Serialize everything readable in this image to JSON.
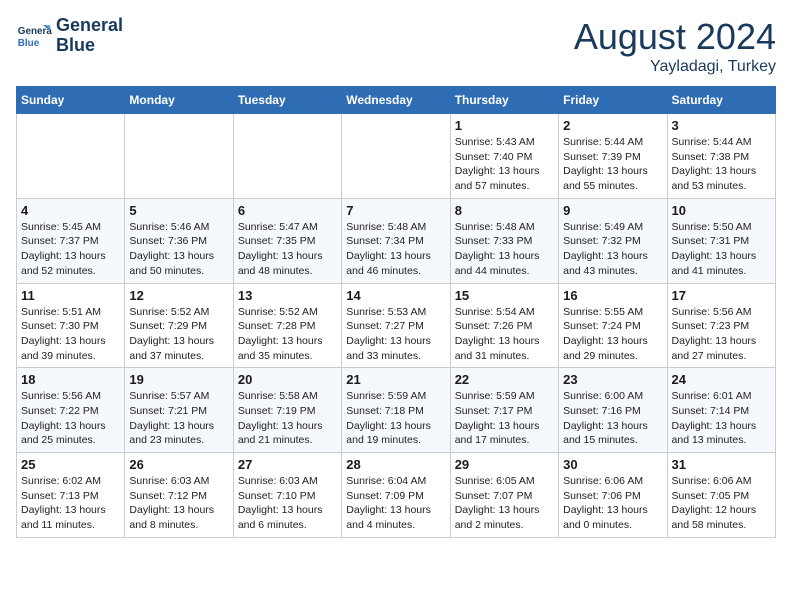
{
  "header": {
    "logo_line1": "General",
    "logo_line2": "Blue",
    "month_year": "August 2024",
    "location": "Yayladagi, Turkey"
  },
  "days_of_week": [
    "Sunday",
    "Monday",
    "Tuesday",
    "Wednesday",
    "Thursday",
    "Friday",
    "Saturday"
  ],
  "weeks": [
    [
      {
        "day": "",
        "info": ""
      },
      {
        "day": "",
        "info": ""
      },
      {
        "day": "",
        "info": ""
      },
      {
        "day": "",
        "info": ""
      },
      {
        "day": "1",
        "info": "Sunrise: 5:43 AM\nSunset: 7:40 PM\nDaylight: 13 hours\nand 57 minutes."
      },
      {
        "day": "2",
        "info": "Sunrise: 5:44 AM\nSunset: 7:39 PM\nDaylight: 13 hours\nand 55 minutes."
      },
      {
        "day": "3",
        "info": "Sunrise: 5:44 AM\nSunset: 7:38 PM\nDaylight: 13 hours\nand 53 minutes."
      }
    ],
    [
      {
        "day": "4",
        "info": "Sunrise: 5:45 AM\nSunset: 7:37 PM\nDaylight: 13 hours\nand 52 minutes."
      },
      {
        "day": "5",
        "info": "Sunrise: 5:46 AM\nSunset: 7:36 PM\nDaylight: 13 hours\nand 50 minutes."
      },
      {
        "day": "6",
        "info": "Sunrise: 5:47 AM\nSunset: 7:35 PM\nDaylight: 13 hours\nand 48 minutes."
      },
      {
        "day": "7",
        "info": "Sunrise: 5:48 AM\nSunset: 7:34 PM\nDaylight: 13 hours\nand 46 minutes."
      },
      {
        "day": "8",
        "info": "Sunrise: 5:48 AM\nSunset: 7:33 PM\nDaylight: 13 hours\nand 44 minutes."
      },
      {
        "day": "9",
        "info": "Sunrise: 5:49 AM\nSunset: 7:32 PM\nDaylight: 13 hours\nand 43 minutes."
      },
      {
        "day": "10",
        "info": "Sunrise: 5:50 AM\nSunset: 7:31 PM\nDaylight: 13 hours\nand 41 minutes."
      }
    ],
    [
      {
        "day": "11",
        "info": "Sunrise: 5:51 AM\nSunset: 7:30 PM\nDaylight: 13 hours\nand 39 minutes."
      },
      {
        "day": "12",
        "info": "Sunrise: 5:52 AM\nSunset: 7:29 PM\nDaylight: 13 hours\nand 37 minutes."
      },
      {
        "day": "13",
        "info": "Sunrise: 5:52 AM\nSunset: 7:28 PM\nDaylight: 13 hours\nand 35 minutes."
      },
      {
        "day": "14",
        "info": "Sunrise: 5:53 AM\nSunset: 7:27 PM\nDaylight: 13 hours\nand 33 minutes."
      },
      {
        "day": "15",
        "info": "Sunrise: 5:54 AM\nSunset: 7:26 PM\nDaylight: 13 hours\nand 31 minutes."
      },
      {
        "day": "16",
        "info": "Sunrise: 5:55 AM\nSunset: 7:24 PM\nDaylight: 13 hours\nand 29 minutes."
      },
      {
        "day": "17",
        "info": "Sunrise: 5:56 AM\nSunset: 7:23 PM\nDaylight: 13 hours\nand 27 minutes."
      }
    ],
    [
      {
        "day": "18",
        "info": "Sunrise: 5:56 AM\nSunset: 7:22 PM\nDaylight: 13 hours\nand 25 minutes."
      },
      {
        "day": "19",
        "info": "Sunrise: 5:57 AM\nSunset: 7:21 PM\nDaylight: 13 hours\nand 23 minutes."
      },
      {
        "day": "20",
        "info": "Sunrise: 5:58 AM\nSunset: 7:19 PM\nDaylight: 13 hours\nand 21 minutes."
      },
      {
        "day": "21",
        "info": "Sunrise: 5:59 AM\nSunset: 7:18 PM\nDaylight: 13 hours\nand 19 minutes."
      },
      {
        "day": "22",
        "info": "Sunrise: 5:59 AM\nSunset: 7:17 PM\nDaylight: 13 hours\nand 17 minutes."
      },
      {
        "day": "23",
        "info": "Sunrise: 6:00 AM\nSunset: 7:16 PM\nDaylight: 13 hours\nand 15 minutes."
      },
      {
        "day": "24",
        "info": "Sunrise: 6:01 AM\nSunset: 7:14 PM\nDaylight: 13 hours\nand 13 minutes."
      }
    ],
    [
      {
        "day": "25",
        "info": "Sunrise: 6:02 AM\nSunset: 7:13 PM\nDaylight: 13 hours\nand 11 minutes."
      },
      {
        "day": "26",
        "info": "Sunrise: 6:03 AM\nSunset: 7:12 PM\nDaylight: 13 hours\nand 8 minutes."
      },
      {
        "day": "27",
        "info": "Sunrise: 6:03 AM\nSunset: 7:10 PM\nDaylight: 13 hours\nand 6 minutes."
      },
      {
        "day": "28",
        "info": "Sunrise: 6:04 AM\nSunset: 7:09 PM\nDaylight: 13 hours\nand 4 minutes."
      },
      {
        "day": "29",
        "info": "Sunrise: 6:05 AM\nSunset: 7:07 PM\nDaylight: 13 hours\nand 2 minutes."
      },
      {
        "day": "30",
        "info": "Sunrise: 6:06 AM\nSunset: 7:06 PM\nDaylight: 13 hours\nand 0 minutes."
      },
      {
        "day": "31",
        "info": "Sunrise: 6:06 AM\nSunset: 7:05 PM\nDaylight: 12 hours\nand 58 minutes."
      }
    ]
  ]
}
